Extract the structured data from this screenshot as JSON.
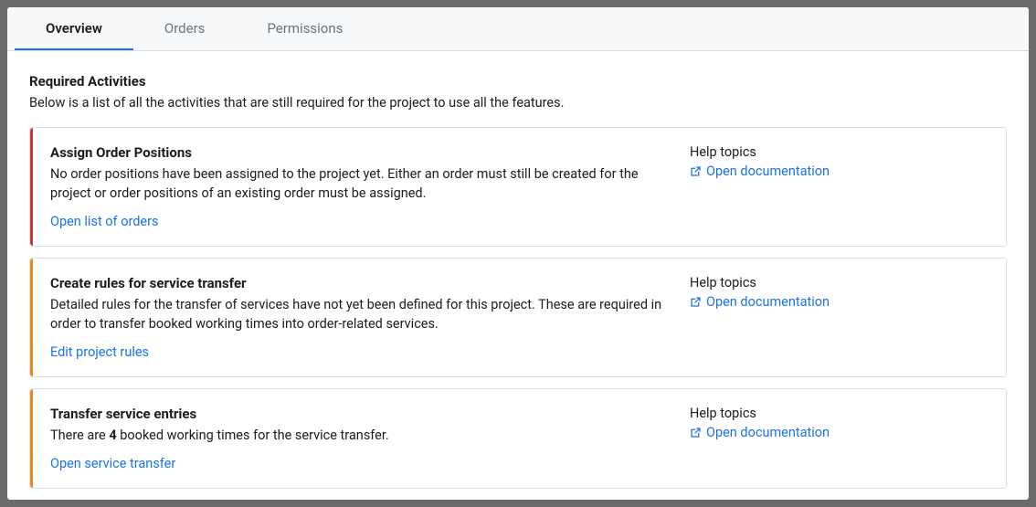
{
  "tabs": {
    "overview": "Overview",
    "orders": "Orders",
    "permissions": "Permissions"
  },
  "section": {
    "title": "Required Activities",
    "description": "Below is a list of all the activities that are still required for the project to use all the features."
  },
  "help_label": "Help topics",
  "open_doc": "Open documentation",
  "cards": {
    "assign_positions": {
      "title": "Assign Order Positions",
      "description": "No order positions have been assigned to the project yet. Either an order must still be created for the project or order positions of an existing order must be assigned.",
      "action": "Open list of orders",
      "accent": "red"
    },
    "create_rules": {
      "title": "Create rules for service transfer",
      "description": "Detailed rules for the transfer of services have not yet been defined for this project. These are required in order to transfer booked working times into order-related services.",
      "action": "Edit project rules",
      "accent": "orange"
    },
    "transfer_entries": {
      "title": "Transfer service entries",
      "desc_prefix": "There are ",
      "count": "4",
      "desc_suffix": " booked working times for the service transfer.",
      "action": "Open service transfer",
      "accent": "orange"
    }
  }
}
